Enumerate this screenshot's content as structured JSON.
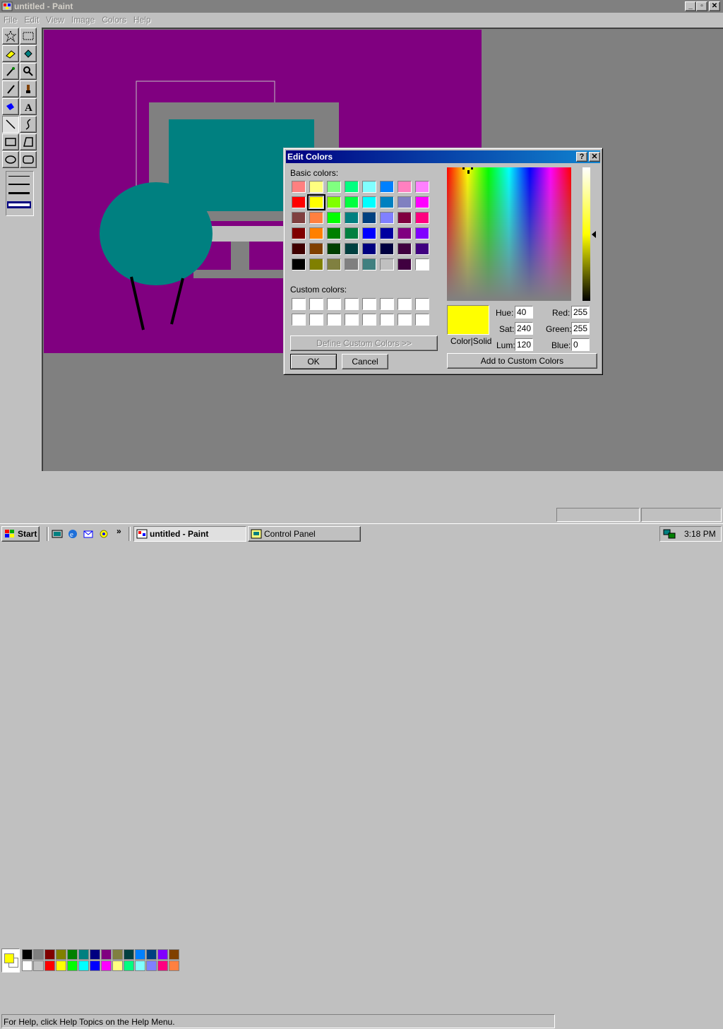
{
  "window": {
    "title": "untitled - Paint",
    "min": "_",
    "max": "▫",
    "close": "✕"
  },
  "menu": [
    "File",
    "Edit",
    "View",
    "Image",
    "Colors",
    "Help"
  ],
  "status": {
    "help_text": "For Help, click Help Topics on the Help Menu."
  },
  "taskbar": {
    "start": "Start",
    "tasks": [
      "untitled - Paint",
      "Control Panel"
    ],
    "clock": "3:18 PM",
    "chevron": "»"
  },
  "palette": {
    "top": [
      "#000000",
      "#808080",
      "#800000",
      "#808000",
      "#008000",
      "#008080",
      "#000080",
      "#800080",
      "#808040",
      "#004040",
      "#0080ff",
      "#004080",
      "#8000ff",
      "#804000"
    ],
    "bottom": [
      "#ffffff",
      "#c0c0c0",
      "#ff0000",
      "#ffff00",
      "#00ff00",
      "#00ffff",
      "#0000ff",
      "#ff00ff",
      "#ffff80",
      "#00ff80",
      "#80ffff",
      "#8080ff",
      "#ff0080",
      "#ff8040"
    ],
    "foreground": "#ffff00",
    "background": "#ffffff"
  },
  "dialog": {
    "title": "Edit Colors",
    "help_btn": "?",
    "close_btn": "✕",
    "basic_label": "Basic colors:",
    "custom_label": "Custom colors:",
    "define_btn": "Define Custom Colors >>",
    "ok_btn": "OK",
    "cancel_btn": "Cancel",
    "add_btn": "Add to Custom Colors",
    "color_solid": "Color|Solid",
    "basic_colors": [
      [
        "#ff8080",
        "#ffff80",
        "#80ff80",
        "#00ff80",
        "#80ffff",
        "#0080ff",
        "#ff80c0",
        "#ff80ff"
      ],
      [
        "#ff0000",
        "#ffff00",
        "#80ff00",
        "#00ff40",
        "#00ffff",
        "#0080c0",
        "#8080c0",
        "#ff00ff"
      ],
      [
        "#804040",
        "#ff8040",
        "#00ff00",
        "#008080",
        "#004080",
        "#8080ff",
        "#800040",
        "#ff0080"
      ],
      [
        "#800000",
        "#ff8000",
        "#008000",
        "#008040",
        "#0000ff",
        "#0000a0",
        "#800080",
        "#8000ff"
      ],
      [
        "#400000",
        "#804000",
        "#004000",
        "#004040",
        "#000080",
        "#000040",
        "#400040",
        "#400080"
      ],
      [
        "#000000",
        "#808000",
        "#808040",
        "#808080",
        "#408080",
        "#c0c0c0",
        "#400040",
        "#ffffff"
      ]
    ],
    "selected_basic": "#ffff00",
    "custom_colors": [
      "#ffffff",
      "#ffffff",
      "#ffffff",
      "#ffffff",
      "#ffffff",
      "#ffffff",
      "#ffffff",
      "#ffffff",
      "#ffffff",
      "#ffffff",
      "#ffffff",
      "#ffffff",
      "#ffffff",
      "#ffffff",
      "#ffffff",
      "#ffffff"
    ],
    "preview_color": "#ffff00",
    "fields": {
      "hue_label": "Hue:",
      "hue": "40",
      "sat_label": "Sat:",
      "sat": "240",
      "lum_label": "Lum:",
      "lum": "120",
      "red_label": "Red:",
      "red": "255",
      "green_label": "Green:",
      "green": "255",
      "blue_label": "Blue:",
      "blue": "0"
    }
  }
}
